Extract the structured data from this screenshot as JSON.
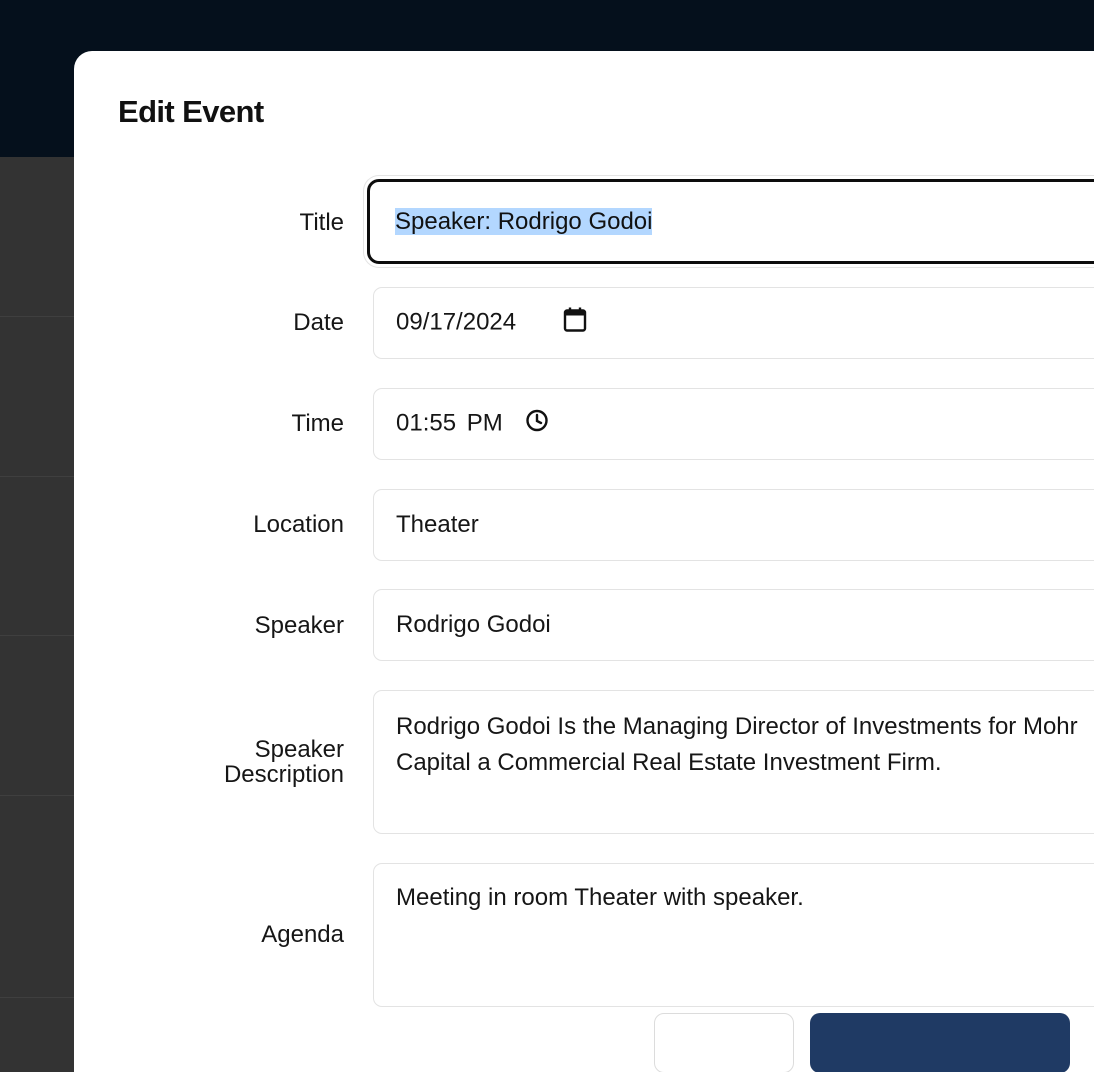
{
  "modal": {
    "title": "Edit Event"
  },
  "fields": {
    "title": {
      "label": "Title",
      "value": "Speaker: Rodrigo Godoi"
    },
    "date": {
      "label": "Date",
      "value": "09/17/2024",
      "icon": "calendar-icon"
    },
    "time": {
      "label": "Time",
      "value": "01:55 PM",
      "icon": "clock-icon"
    },
    "location": {
      "label": "Location",
      "value": "Theater"
    },
    "speaker": {
      "label": "Speaker",
      "value": "Rodrigo Godoi"
    },
    "speaker_description": {
      "label_line1": "Speaker",
      "label_line2": "Description",
      "value": "Rodrigo Godoi Is the Managing Director of Investments for Mohr Capital a Commercial Real Estate Investment Firm."
    },
    "agenda": {
      "label": "Agenda",
      "value": "Meeting in room Theater with speaker."
    }
  },
  "colors": {
    "overlay_top": "#05101c",
    "overlay_body": "#333333",
    "primary_button": "#1f3a64",
    "selection": "#b3d7ff"
  }
}
